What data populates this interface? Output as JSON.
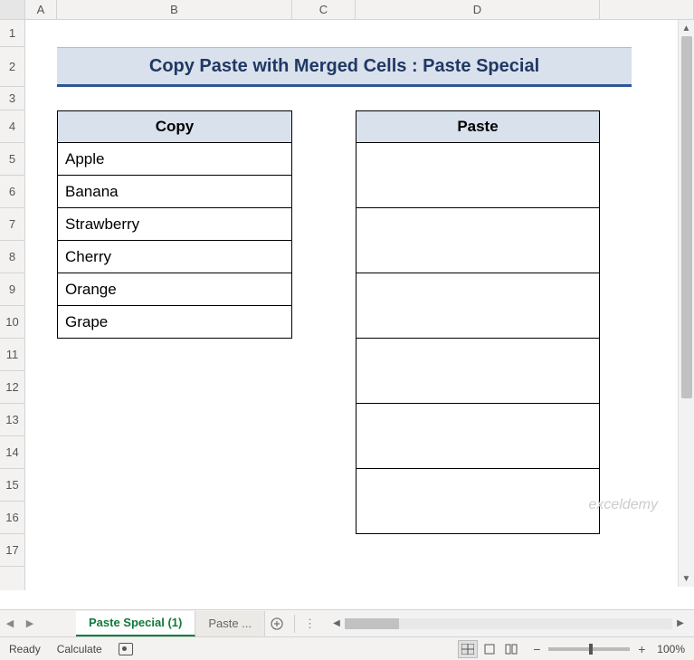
{
  "columns": [
    "A",
    "B",
    "C",
    "D"
  ],
  "rows": [
    "1",
    "2",
    "3",
    "4",
    "5",
    "6",
    "7",
    "8",
    "9",
    "10",
    "11",
    "12",
    "13",
    "14",
    "15",
    "16",
    "17"
  ],
  "title": "Copy Paste with Merged Cells : Paste Special",
  "copy_table": {
    "header": "Copy",
    "items": [
      "Apple",
      "Banana",
      "Strawberry",
      "Cherry",
      "Orange",
      "Grape"
    ]
  },
  "paste_table": {
    "header": "Paste",
    "items": [
      "",
      "",
      "",
      "",
      "",
      ""
    ]
  },
  "tabs": {
    "active": "Paste Special (1)",
    "others": [
      "Paste ..."
    ]
  },
  "status": {
    "ready": "Ready",
    "calc": "Calculate",
    "zoom": "100%"
  },
  "watermark": "exceldemy"
}
